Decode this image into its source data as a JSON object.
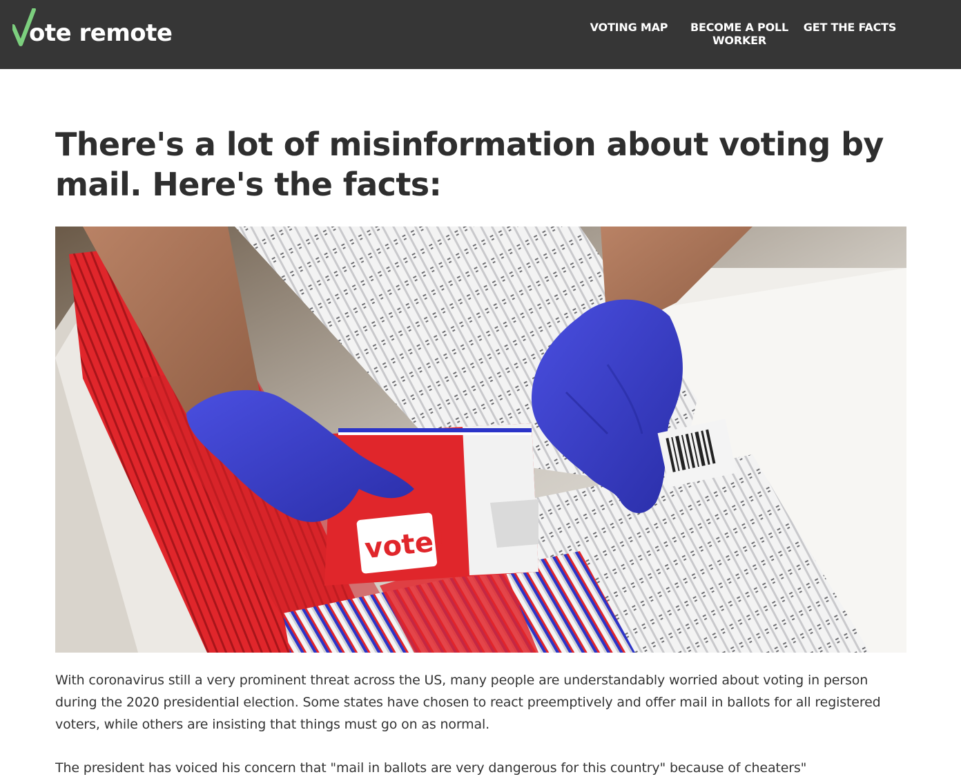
{
  "header": {
    "logo": {
      "text": "ote remote",
      "check_color": "#7ccf7e",
      "icon": "checkmark-v-icon"
    },
    "nav": [
      {
        "label": "VOTING MAP"
      },
      {
        "label": "BECOME A POLL WORKER"
      },
      {
        "label": "GET THE FACTS"
      }
    ],
    "background": "#363636"
  },
  "main": {
    "title": "There's a lot of misinformation about voting by mail. Here's the facts:",
    "hero_image": {
      "envelope_text": "vote!"
    },
    "paragraphs": [
      "With coronavirus still a very prominent threat across the US, many people are understandably worried about voting in person during the 2020 presidential election. Some states have chosen to react preemptively and offer mail in ballots for all registered voters, while others are insisting that things must go on as normal.",
      "The president has voiced his concern that \"mail in ballots are very dangerous for this country\" because of cheaters\""
    ]
  },
  "colors": {
    "text_dark": "#2e2e2e",
    "glove_blue": "#3b3fd0",
    "envelope_red": "#e0262b"
  }
}
